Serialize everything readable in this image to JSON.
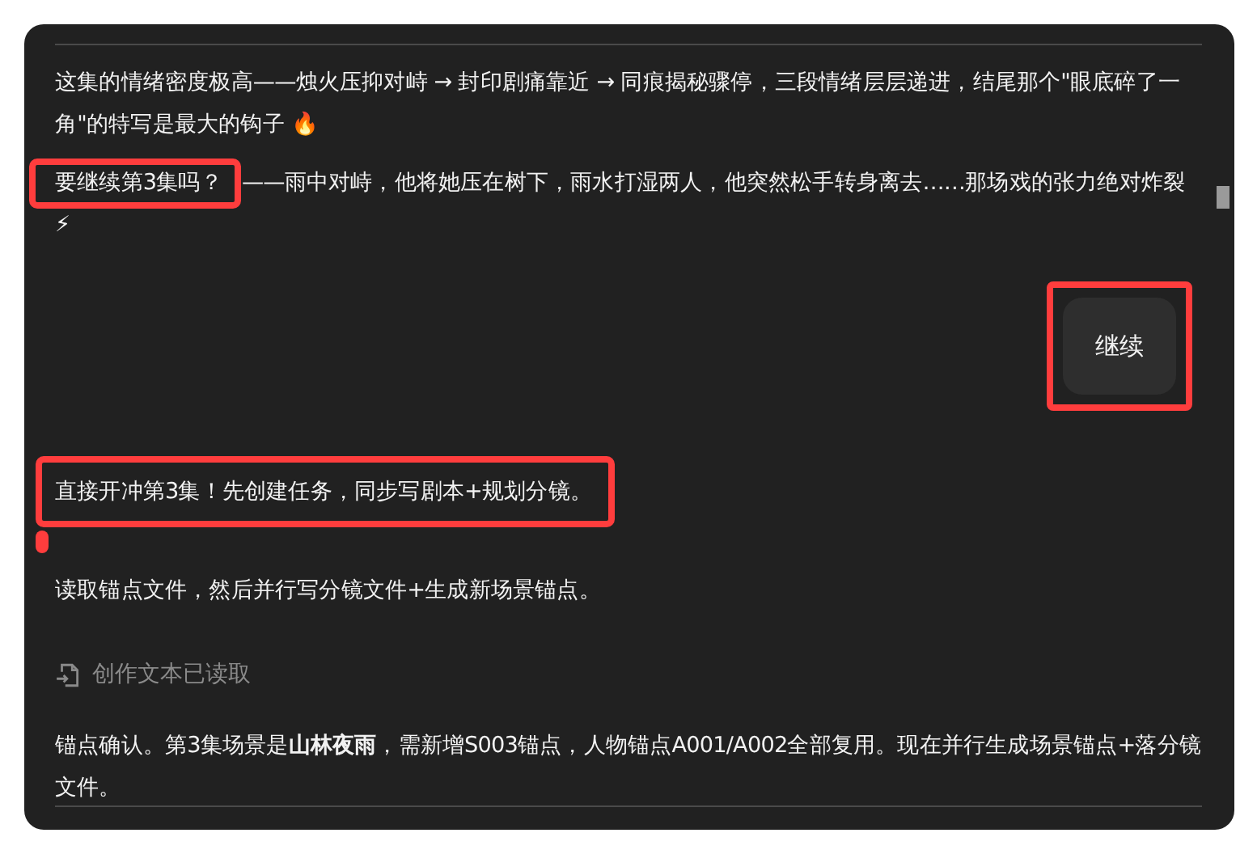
{
  "blocks": [
    {
      "kind": "paragraph",
      "parts": [
        {
          "text": "这集的情绪密度极高——烛火压抑对峙 → 封印剧痛靠近 → 同痕揭秘骤停，三段情绪层层递进，结尾那个\"眼底碎了一角\"的特写是最大的钩子 🔥",
          "highlighted": false
        }
      ]
    },
    {
      "kind": "paragraph",
      "parts": [
        {
          "text": "要继续第3集吗？",
          "highlighted": true
        },
        {
          "text": "——雨中对峙，他将她压在树下，雨水打湿两人，他突然松手转身离去……那场戏的张力绝对炸裂 ⚡",
          "highlighted": false
        }
      ]
    },
    {
      "kind": "reply",
      "text": "继续",
      "highlighted": true
    },
    {
      "kind": "paragraph",
      "parts": [
        {
          "text": "直接开冲第3集！先创建任务，同步写剧本+规划分镜。",
          "highlighted": true
        }
      ]
    },
    {
      "kind": "marker"
    },
    {
      "kind": "paragraph",
      "parts": [
        {
          "text": "读取锚点文件，然后并行写分镜文件+生成新场景锚点。",
          "highlighted": false
        }
      ]
    },
    {
      "kind": "status",
      "text": "创作文本已读取"
    },
    {
      "kind": "paragraph",
      "parts": [
        {
          "text": "锚点确认。第3集场景是**山林夜雨**，需新增S003锚点，人物锚点A001/A002全部复用。现在并行生成场景锚点+落分镜文件。",
          "highlighted": false
        }
      ]
    }
  ]
}
